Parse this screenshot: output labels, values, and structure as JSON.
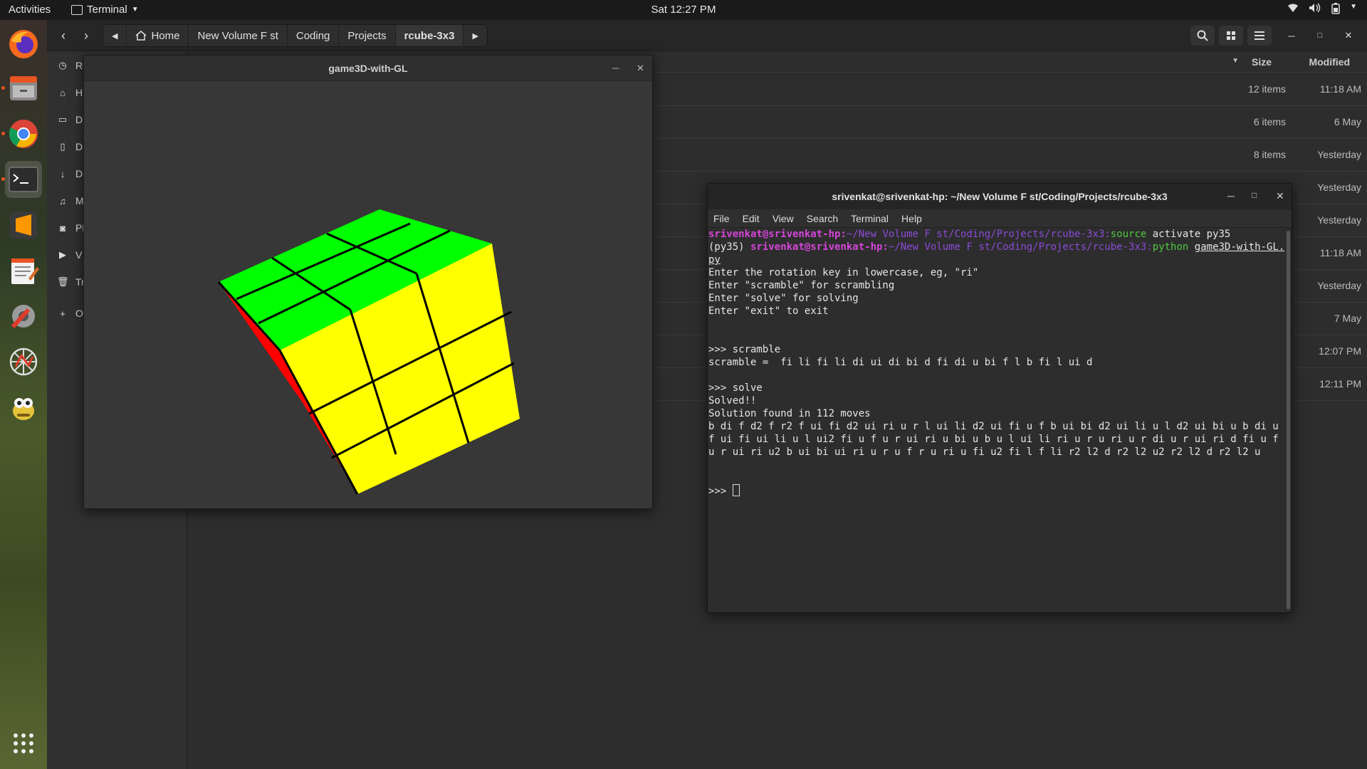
{
  "topbar": {
    "activities": "Activities",
    "app_name": "Terminal",
    "clock": "Sat 12:27 PM"
  },
  "dock": {
    "items": [
      "firefox",
      "files",
      "chrome",
      "terminal",
      "sublime-text",
      "text-editor",
      "settings-tools",
      "network-tool",
      "game-app",
      "show-apps"
    ]
  },
  "files": {
    "breadcrumbs": [
      "Home",
      "New Volume F st",
      "Coding",
      "Projects",
      "rcube-3x3"
    ],
    "sidebar": [
      {
        "icon": "clock-icon",
        "label": "Re"
      },
      {
        "icon": "home-icon",
        "label": "H"
      },
      {
        "icon": "folder-icon",
        "label": "D"
      },
      {
        "icon": "document-icon",
        "label": "D"
      },
      {
        "icon": "download-icon",
        "label": "D"
      },
      {
        "icon": "music-icon",
        "label": "M"
      },
      {
        "icon": "camera-icon",
        "label": "Pi"
      },
      {
        "icon": "video-icon",
        "label": "V"
      },
      {
        "icon": "trash-icon",
        "label": "Tr"
      },
      {
        "icon": "plus-icon",
        "label": "O"
      }
    ],
    "columns": {
      "size": "Size",
      "modified": "Modified"
    },
    "rows": [
      {
        "size": "12 items",
        "modified": "11:18 AM"
      },
      {
        "size": "6 items",
        "modified": "6 May"
      },
      {
        "size": "8 items",
        "modified": "Yesterday"
      },
      {
        "size": "",
        "modified": "Yesterday"
      },
      {
        "size": "",
        "modified": "Yesterday"
      },
      {
        "size": "",
        "modified": "11:18 AM"
      },
      {
        "size": "",
        "modified": "Yesterday"
      },
      {
        "size": "",
        "modified": "7 May"
      },
      {
        "size": "",
        "modified": "12:07 PM"
      },
      {
        "size": "",
        "modified": "12:11 PM"
      }
    ]
  },
  "glwindow": {
    "title": "game3D-with-GL",
    "colors": {
      "top": "#00ff00",
      "front": "#ffff00",
      "left": "#ff0000",
      "line": "#000000",
      "bg": "#373737"
    }
  },
  "terminal": {
    "title": "srivenkat@srivenkat-hp: ~/New Volume F st/Coding/Projects/rcube-3x3",
    "menu": [
      "File",
      "Edit",
      "View",
      "Search",
      "Terminal",
      "Help"
    ],
    "prompt_user": "srivenkat@srivenkat-hp",
    "prompt_path": "~/New Volume F st/Coding/Projects/rcube-3x3",
    "cmd1_name": "source",
    "cmd1_args": " activate py35",
    "env": "(py35) ",
    "cmd2_name": "python",
    "cmd2_file": "game3D-with-GL.py",
    "output": [
      "Enter the rotation key in lowercase, eg, \"ri\"",
      "Enter \"scramble\" for scrambling",
      "Enter \"solve\" for solving",
      "Enter \"exit\" to exit",
      "",
      "",
      ">>> scramble",
      "scramble =  fi li fi li di ui di bi d fi di u bi f l b fi l ui d",
      "",
      ">>> solve",
      "Solved!!",
      "Solution found in 112 moves",
      "b di f d2 f r2 f ui fi d2 ui ri u r l ui li d2 ui fi u f b ui bi d2 ui li u l d2 ui bi u b di u f ui fi ui li u l ui2 fi u f u r ui ri u bi u b u l ui li ri u r u ri u r di u r ui ri d fi u f u r ui ri u2 b ui bi ui ri u r u f r u ri u fi u2 fi l f li r2 l2 d r2 l2 u2 r2 l2 d r2 l2 u",
      "",
      ""
    ],
    "final_prompt": ">>> "
  }
}
